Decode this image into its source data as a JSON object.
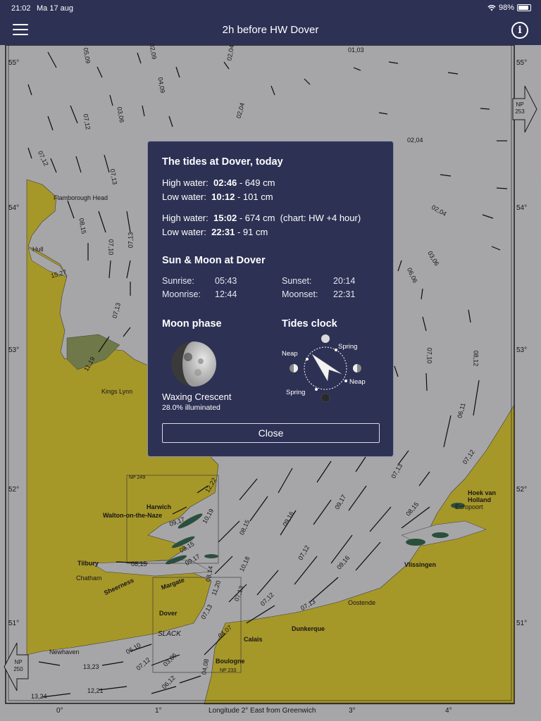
{
  "status": {
    "time": "21:02",
    "date": "Ma 17 aug",
    "battery": "98%"
  },
  "nav": {
    "title": "2h before HW Dover",
    "menu_icon": "hamburger-icon",
    "info_icon": "info-icon"
  },
  "map": {
    "lat_labels": [
      "55°",
      "54°",
      "53°",
      "52°",
      "51°"
    ],
    "lon_labels": [
      "0°",
      "1°",
      "3°",
      "4°"
    ],
    "lon_title": "Longitude 2° East from Greenwich",
    "np_chart_top": "NP 253",
    "np_chart_left": "NP 250",
    "np_249": "NP 249",
    "np_233": "NP 233",
    "places": {
      "flamborough": "Flamborough Head",
      "hull": "Hull",
      "kings_lynn": "Kings Lynn",
      "harwich": "Harwich",
      "walton": "Walton-on-the-Naze",
      "tilbury": "Tilbury",
      "chatham": "Chatham",
      "sheerness": "Sheerness",
      "margate": "Margate",
      "dover": "Dover",
      "slack": "SLACK",
      "newhaven": "Newhaven",
      "calais": "Calais",
      "boulogne": "Boulogne",
      "dunkerque": "Dunkerque",
      "oostende": "Oostende",
      "vlissingen": "Vlissingen",
      "hoek": "Hoek van",
      "holland": "Holland",
      "europoort": "Europoort"
    },
    "rates": [
      "05,09",
      "02,09",
      "02,04",
      "01,03",
      "04,09",
      "07,12",
      "03,06",
      "02,04",
      "02,04",
      "07,12",
      "07,13",
      "08,15",
      "07,10",
      "07,13",
      "15,27",
      "07,13",
      "11,19",
      "13,23",
      "13,24",
      "12,21",
      "06,10",
      "07,12",
      "03,06",
      "06,12",
      "04,08",
      "04,07",
      "07,13",
      "11,20",
      "08,14",
      "07,13",
      "10,18",
      "08,15",
      "09,16",
      "07,12",
      "09,17",
      "07,13",
      "07,12",
      "08,15",
      "09,16",
      "07,12",
      "07,13",
      "06,11",
      "07,10",
      "08,12",
      "06,06",
      "03,06",
      "02,04",
      "08,15",
      "09,17",
      "12,22",
      "10,19",
      "09,17",
      "08,15"
    ]
  },
  "dialog": {
    "title": "The tides at Dover, today",
    "tides": [
      {
        "type": "High water:",
        "time": "02:46",
        "height": "- 649 cm",
        "note": ""
      },
      {
        "type": "Low water:",
        "time": "10:12",
        "height": "- 101 cm",
        "note": ""
      },
      {
        "type": "High water:",
        "time": "15:02",
        "height": "- 674 cm",
        "note": "(chart: HW +4 hour)"
      },
      {
        "type": "Low water:",
        "time": "22:31",
        "height": "- 91 cm",
        "note": ""
      }
    ],
    "sun_moon_title": "Sun & Moon at Dover",
    "sunrise_label": "Sunrise:",
    "sunrise": "05:43",
    "sunset_label": "Sunset:",
    "sunset": "20:14",
    "moonrise_label": "Moonrise:",
    "moonrise": "12:44",
    "moonset_label": "Moonset:",
    "moonset": "22:31",
    "moon_phase_title": "Moon phase",
    "moon_phase_name": "Waxing Crescent",
    "moon_illumination": "28.0% illuminated",
    "tides_clock_title": "Tides clock",
    "clock_labels": {
      "neap_top": "Neap",
      "spring_top": "Spring",
      "neap_bottom": "Neap",
      "spring_bottom": "Spring"
    },
    "close_label": "Close"
  },
  "colors": {
    "bar": "#2d3154",
    "land": "#e6d13a",
    "sea": "#e6e7ea",
    "dialog": "#2d3154"
  }
}
